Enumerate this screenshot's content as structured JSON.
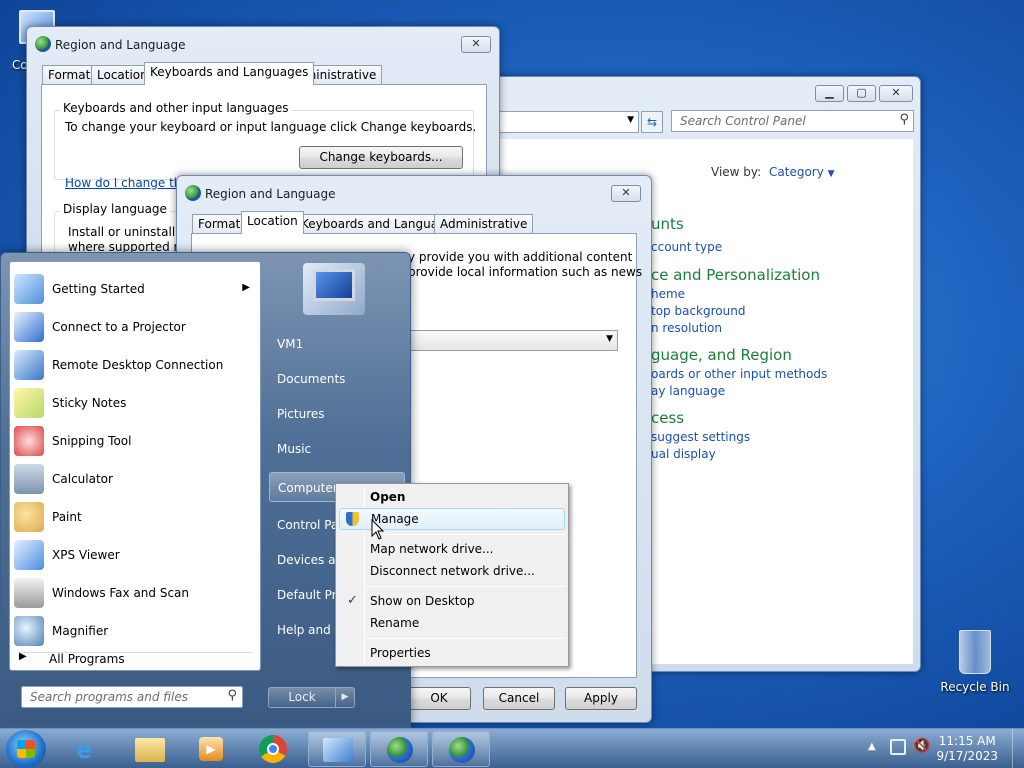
{
  "desktop": {
    "computer_icon_label": "Co",
    "recycle_bin_label": "Recycle Bin"
  },
  "control_panel": {
    "search_placeholder": "Search Control Panel",
    "view_by_label": "View by:",
    "view_by_value": "Category",
    "headings": [
      "unts",
      "ce and Personalization",
      "guage, and Region",
      "cess"
    ],
    "links": [
      "ccount type",
      "heme",
      "top background",
      "n resolution",
      "oards or other input methods",
      "ay language",
      "suggest settings",
      "ual display"
    ]
  },
  "region_back": {
    "title": "Region and Language",
    "tabs": [
      "Formats",
      "Location",
      "Keyboards and Languages",
      "Administrative"
    ],
    "group1_title": "Keyboards and other input languages",
    "group1_text": "To change your keyboard or input language click Change keyboards.",
    "change_keyboards": "Change keyboards...",
    "howto_link": "How do I change the",
    "group2_title": "Display language",
    "group2_line1": "Install or uninstall lar",
    "group2_line2": "where supported rec"
  },
  "region_front": {
    "title": "Region and Language",
    "tabs": [
      "Formats",
      "Location",
      "Keyboards and Languages",
      "Administrative"
    ],
    "text_line1": "y provide you with additional content",
    "text_line2": "provide local information such as news",
    "ok": "OK",
    "cancel": "Cancel",
    "apply": "Apply"
  },
  "start_menu": {
    "programs": [
      "Getting Started",
      "Connect to a Projector",
      "Remote Desktop Connection",
      "Sticky Notes",
      "Snipping Tool",
      "Calculator",
      "Paint",
      "XPS Viewer",
      "Windows Fax and Scan",
      "Magnifier"
    ],
    "all_programs": "All Programs",
    "search_placeholder": "Search programs and files",
    "right_items": [
      "VM1",
      "Documents",
      "Pictures",
      "Music",
      "Computer",
      "Control Panel",
      "Devices and Printers",
      "Default Programs",
      "Help and Support"
    ],
    "lock": "Lock"
  },
  "context_menu": {
    "items": [
      "Open",
      "Manage",
      "Map network drive...",
      "Disconnect network drive...",
      "Show on Desktop",
      "Rename",
      "Properties"
    ]
  },
  "taskbar": {
    "time": "11:15 AM",
    "date": "9/17/2023"
  }
}
